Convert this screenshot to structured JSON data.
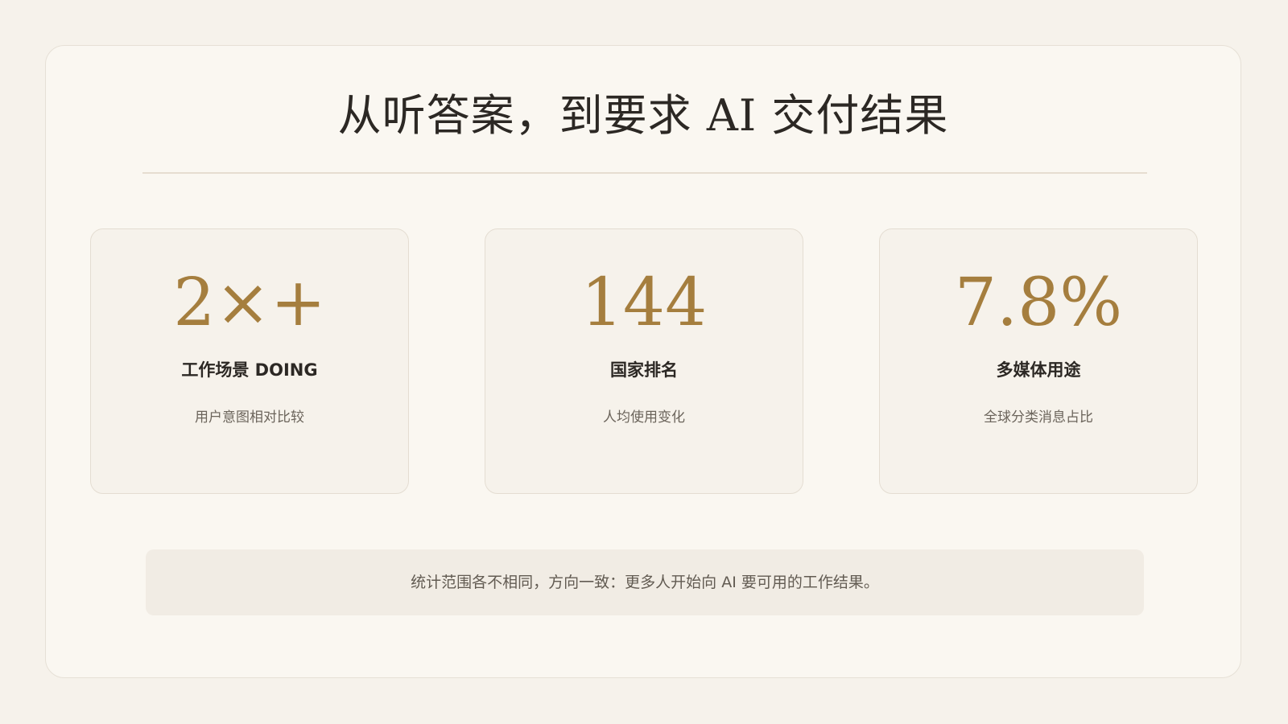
{
  "slide": {
    "title": "从听答案，到要求 AI 交付结果",
    "stats": [
      {
        "value": "2×+",
        "label": "工作场景 DOING",
        "description": "用户意图相对比较"
      },
      {
        "value": "144",
        "label": "国家排名",
        "description": "人均使用变化"
      },
      {
        "value": "7.8%",
        "label": "多媒体用途",
        "description": "全球分类消息占比"
      }
    ],
    "footnote": "统计范围各不相同，方向一致：更多人开始向 AI 要可用的工作结果。"
  },
  "colors": {
    "background": "#f6f2eb",
    "panel": "#faf7f1",
    "accent_gold": "#a57e3e",
    "heading_text": "#2c2824",
    "muted_text": "#6b645b"
  }
}
